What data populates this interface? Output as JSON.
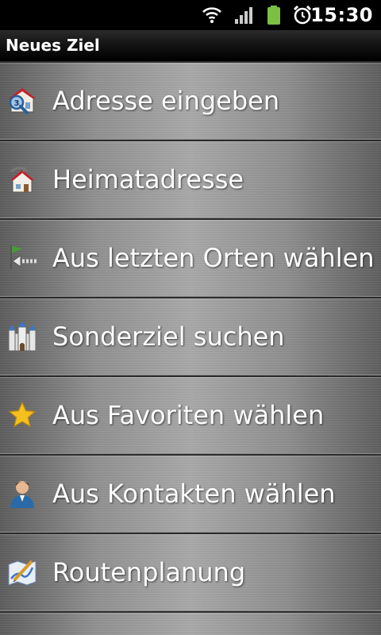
{
  "status_bar": {
    "time": "15:30",
    "icons": [
      "wifi-icon",
      "signal-icon",
      "battery-icon",
      "alarm-icon"
    ],
    "battery_color": "#7bc043"
  },
  "header": {
    "title": "Neues Ziel"
  },
  "menu": {
    "items": [
      {
        "label": "Adresse eingeben",
        "icon": "address-search-icon"
      },
      {
        "label": "Heimatadresse",
        "icon": "home-address-icon"
      },
      {
        "label": "Aus letzten Orten wählen",
        "icon": "recent-places-icon"
      },
      {
        "label": "Sonderziel suchen",
        "icon": "poi-castle-icon"
      },
      {
        "label": "Aus Favoriten wählen",
        "icon": "favorites-star-icon"
      },
      {
        "label": "Aus Kontakten wählen",
        "icon": "contact-person-icon"
      },
      {
        "label": "Routenplanung",
        "icon": "route-planning-icon"
      }
    ]
  }
}
